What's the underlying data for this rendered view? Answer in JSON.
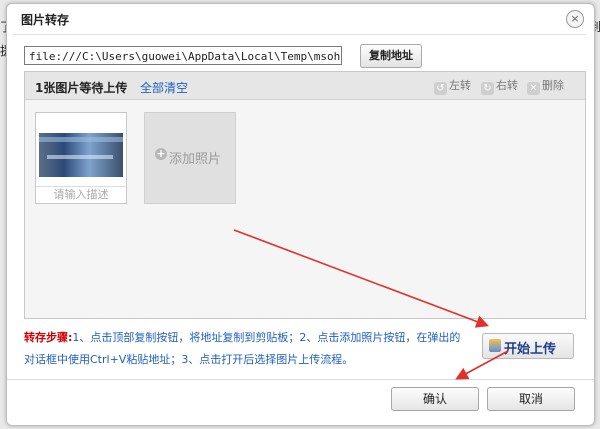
{
  "background": {
    "left_text_1": "了贝",
    "left_text_2": "援",
    "right_text": "到"
  },
  "dialog": {
    "title": "图片转存",
    "close_glyph": "×"
  },
  "path_bar": {
    "value": "file:///C:\\Users\\guowei\\AppData\\Local\\Temp\\msohtmlclip",
    "copy_button": "复制地址"
  },
  "upload_panel": {
    "waiting_label": "1张图片等待上传",
    "clear_all": "全部清空",
    "tools": {
      "rotate_left": "左转",
      "rotate_right": "右转",
      "delete": "删除"
    },
    "thumbnail": {
      "description_placeholder": "请输入描述"
    },
    "add_photo_label": "添加照片"
  },
  "steps": {
    "lead": "转存步骤:",
    "text": "1、点击顶部复制按钮，将地址复制到剪贴板；2、点击添加照片按钮，在弹出的对话框中使用Ctrl+V粘贴地址；3、点击打开后选择图片上传流程。"
  },
  "start_upload_button": "开始上传",
  "footer": {
    "ok": "确认",
    "cancel": "取消"
  },
  "colors": {
    "arrow": "#e0312a",
    "link": "#1f5fbf",
    "lead": "#d40000"
  }
}
